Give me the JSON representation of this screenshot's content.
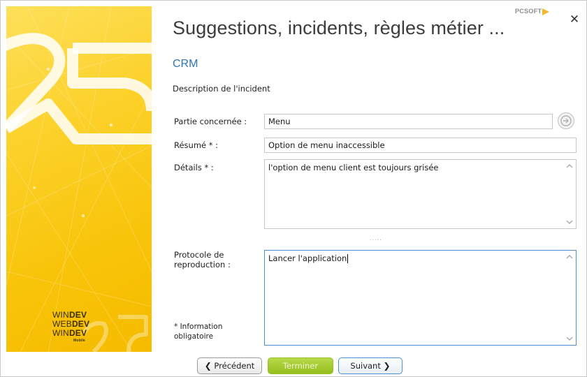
{
  "header": {
    "title": "Suggestions, incidents, règles métier ...",
    "subtitle": "CRM",
    "section_title": "Description de l'incident",
    "pcsoft_logo": "PCSOFT",
    "close_glyph": "✕"
  },
  "banner": {
    "brand_lines": [
      {
        "prefix": "WIN",
        "bold": "DEV"
      },
      {
        "prefix": "WEB",
        "bold": "DEV"
      },
      {
        "prefix": "WIN",
        "bold": "DEV"
      }
    ],
    "mobile_label": "Mobile"
  },
  "form": {
    "part": {
      "label": "Partie concernée :",
      "value": "Menu"
    },
    "summary": {
      "label": "Résumé * :",
      "value": "Option de menu inaccessible"
    },
    "details": {
      "label": "Détails * :",
      "value": "l'option de menu client est toujours grisée"
    },
    "protocol": {
      "label_line1": "Protocole de",
      "label_line2": "reproduction :",
      "value": "Lancer l'application"
    },
    "grip": "....."
  },
  "note": {
    "line1": "* Information",
    "line2": "obligatoire"
  },
  "footer": {
    "prev_label": "Précédent",
    "finish_label": "Terminer",
    "next_label": "Suivant",
    "prev_glyph": "❮",
    "next_glyph": "❯"
  },
  "colors": {
    "accent": "#2f74b5",
    "banner_yellow": "#fcd12a",
    "finish_green": "#a4cb2f"
  },
  "icons": [
    "close-icon",
    "arrow-right-circle-icon",
    "scroll-up-icon",
    "scroll-down-icon",
    "chevron-left-icon",
    "chevron-right-icon"
  ]
}
